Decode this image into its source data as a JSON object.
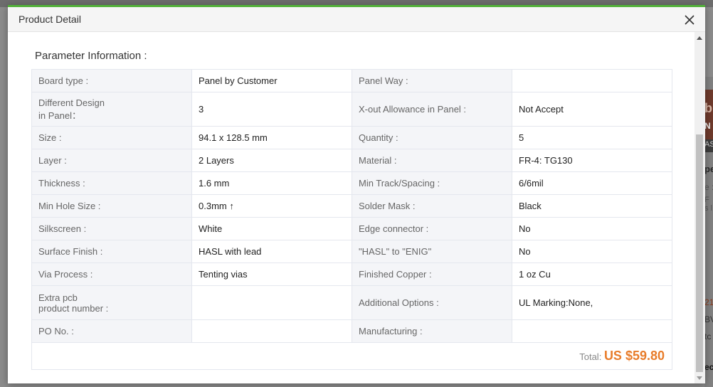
{
  "modal": {
    "title": "Product Detail",
    "close_icon": "close-icon",
    "accent_color": "#52b13a"
  },
  "section": {
    "title": "Parameter Information :"
  },
  "params": [
    {
      "label1": "Board type :",
      "value1": "Panel by Customer",
      "label2": "Panel Way :",
      "value2": ""
    },
    {
      "label1": "Different Design\nin Panel：",
      "value1": "3",
      "label2": "X-out Allowance in Panel :",
      "value2": "Not Accept"
    },
    {
      "label1": "Size :",
      "value1": "94.1 x 128.5 mm",
      "label2": "Quantity :",
      "value2": "5"
    },
    {
      "label1": "Layer :",
      "value1": "2 Layers",
      "label2": "Material :",
      "value2": "FR-4: TG130"
    },
    {
      "label1": "Thickness :",
      "value1": "1.6 mm",
      "label2": "Min Track/Spacing :",
      "value2": "6/6mil"
    },
    {
      "label1": "Min Hole Size :",
      "value1": "0.3mm ↑",
      "label2": "Solder Mask :",
      "value2": "Black"
    },
    {
      "label1": "Silkscreen :",
      "value1": "White",
      "label2": "Edge connector :",
      "value2": "No"
    },
    {
      "label1": "Surface Finish :",
      "value1": "HASL with lead",
      "label2": "\"HASL\" to \"ENIG\"",
      "value2": "No"
    },
    {
      "label1": "Via Process :",
      "value1": "Tenting vias",
      "label2": "Finished Copper :",
      "value2": "1 oz Cu"
    },
    {
      "label1": "Extra pcb\nproduct number :",
      "value1": "",
      "label2": "Additional Options :",
      "value2": "UL Marking:None,"
    },
    {
      "label1": "PO No. :",
      "value1": "",
      "label2": "Manufacturing :",
      "value2": ""
    }
  ],
  "total": {
    "label": "Total:",
    "amount": "US $59.80",
    "color": "#e87c2a"
  },
  "background_page": {
    "fragments": [
      "bl",
      "N",
      "AS",
      "pe",
      "e :",
      "F",
      "s l",
      "21",
      "BV",
      "tc",
      "ec"
    ]
  }
}
